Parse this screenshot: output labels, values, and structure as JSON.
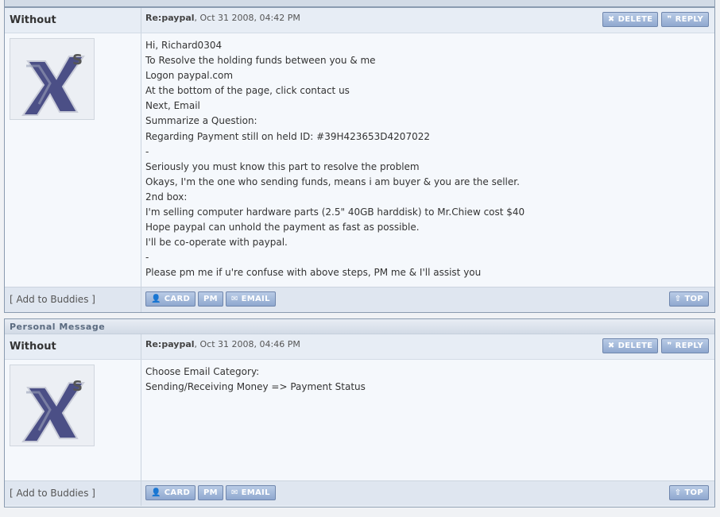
{
  "posts": [
    {
      "author": "Without",
      "meta_subject": "Re:paypal",
      "meta_date": ", Oct 31 2008, 04:42 PM",
      "delete_label": "DELETE",
      "reply_label": "REPLY",
      "lines": [
        "Hi, Richard0304",
        "To Resolve the holding funds between you & me",
        "Logon paypal.com",
        "At the bottom of the page, click contact us",
        "Next, Email",
        "Summarize a Question:",
        "Regarding Payment still on held ID: #39H423653D4207022",
        "-",
        "Seriously you must know this part to resolve the problem",
        "Okays, I'm the one who sending funds, means i am buyer & you are the seller.",
        "2nd box:",
        "I'm selling computer hardware parts (2.5\" 40GB harddisk) to Mr.Chiew cost $40",
        "Hope paypal can unhold the payment as fast as possible.",
        "I'll be co-operate with paypal.",
        "-",
        "Please pm me if u're confuse with above steps, PM me & I'll assist you"
      ],
      "add_buddies": "[ Add to Buddies ]",
      "card_label": "CARD",
      "pm_label": "PM",
      "email_label": "EMAIL",
      "top_label": "TOP"
    },
    {
      "header": "Personal Message",
      "author": "Without",
      "meta_subject": "Re:paypal",
      "meta_date": ", Oct 31 2008, 04:46 PM",
      "delete_label": "DELETE",
      "reply_label": "REPLY",
      "lines": [
        "Choose Email Category:",
        "Sending/Receiving Money => Payment Status"
      ],
      "add_buddies": "[ Add to Buddies ]",
      "card_label": "CARD",
      "pm_label": "PM",
      "email_label": "EMAIL",
      "top_label": "TOP"
    }
  ],
  "icons": {
    "delete": "x-icon",
    "reply": "quote-icon",
    "card": "user-icon",
    "email": "envelope-icon",
    "top": "arrow-up-icon",
    "avatar": "x-logo-icon"
  },
  "colors": {
    "button_bg": "#9bb2d8",
    "button_border": "#6f86ad",
    "header_bg": "#d2dbe6",
    "row_bg": "#e7edf5",
    "body_bg": "#f5f8fc"
  }
}
